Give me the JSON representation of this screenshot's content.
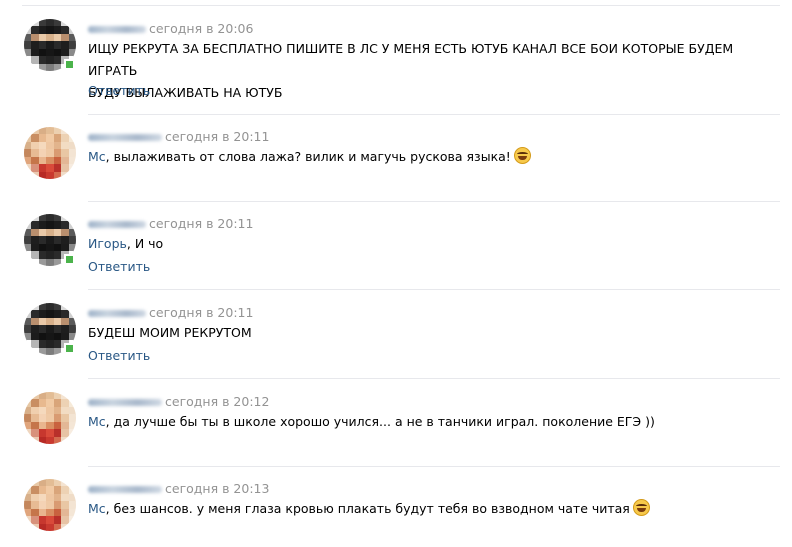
{
  "comments": [
    {
      "time": "сегодня в 20:06",
      "mention": "",
      "text": "ИЩУ РЕКРУТА ЗА БЕСПЛАТНО ПИШИТЕ В ЛС У МЕНЯ ЕСТЬ ЮТУБ КАНАЛ ВСЕ БОИ КОТОРЫЕ БУДЕМ ИГРАТЬ",
      "text2": "БУДУ ВЫЛАЖИВАТЬ НА ЮТУБ",
      "reply": "Ответить",
      "avatar": "ninja"
    },
    {
      "time": "сегодня в 20:11",
      "mention": "Мс",
      "text": ", вылаживать от слова лажа? вилик и магучь рускова языка!",
      "reply": "",
      "avatar": "girl",
      "emoji": "laughing-emoji"
    },
    {
      "time": "сегодня в 20:11",
      "mention": "Игорь",
      "text": ", И чо",
      "reply": "Ответить",
      "avatar": "ninja"
    },
    {
      "time": "сегодня в 20:11",
      "mention": "",
      "text": "БУДЕШ МОИМ РЕКРУТОМ",
      "reply": "Ответить",
      "avatar": "ninja"
    },
    {
      "time": "сегодня в 20:12",
      "mention": "Мс",
      "text": ", да лучше бы ты в школе хорошо учился... а не в танчики играл. поколение ЕГЭ ))",
      "reply": "",
      "avatar": "girl"
    },
    {
      "time": "сегодня в 20:13",
      "mention": "Мс",
      "text": ", без шансов. у меня глаза кровью плакать будут тебя во взводном чате читая",
      "reply": "",
      "avatar": "girl",
      "emoji": "laughing-emoji"
    }
  ],
  "colors": {
    "link": "#2a5885",
    "meta": "#939393",
    "divider": "#e7e8ec",
    "online": "#4bb34b"
  }
}
